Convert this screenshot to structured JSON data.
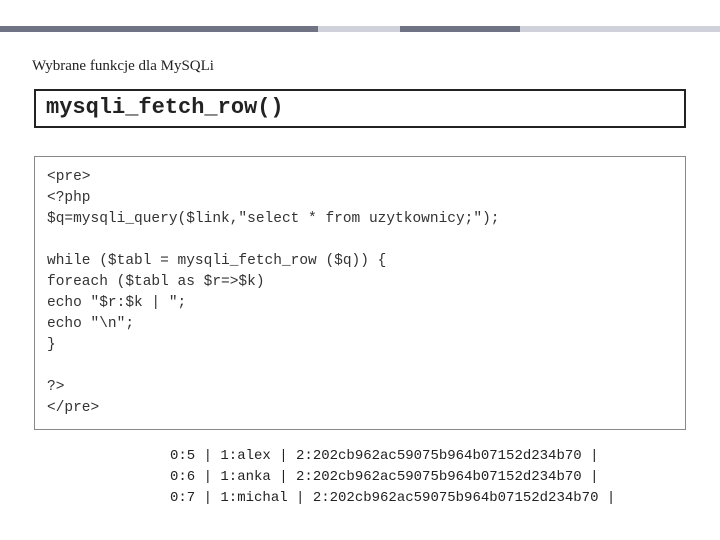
{
  "header": {
    "subtitle": "Wybrane funkcje dla MySQLi",
    "title": "mysqli_fetch_row()"
  },
  "code": {
    "l1": "<pre>",
    "l2": "<?php",
    "l3": "$q=mysqli_query($link,\"select * from uzytkownicy;\");",
    "l4": "",
    "l5": "while ($tabl = mysqli_fetch_row ($q)) {",
    "l6": "foreach ($tabl as $r=>$k)",
    "l7": "echo \"$r:$k | \";",
    "l8": "echo \"\\n\";",
    "l9": "}",
    "l10": "",
    "l11": "?>",
    "l12": "</pre>"
  },
  "output": {
    "r1": "0:5 | 1:alex | 2:202cb962ac59075b964b07152d234b70 |",
    "r2": "0:6 | 1:anka | 2:202cb962ac59075b964b07152d234b70 |",
    "r3": "0:7 | 1:michal | 2:202cb962ac59075b964b07152d234b70 |"
  }
}
